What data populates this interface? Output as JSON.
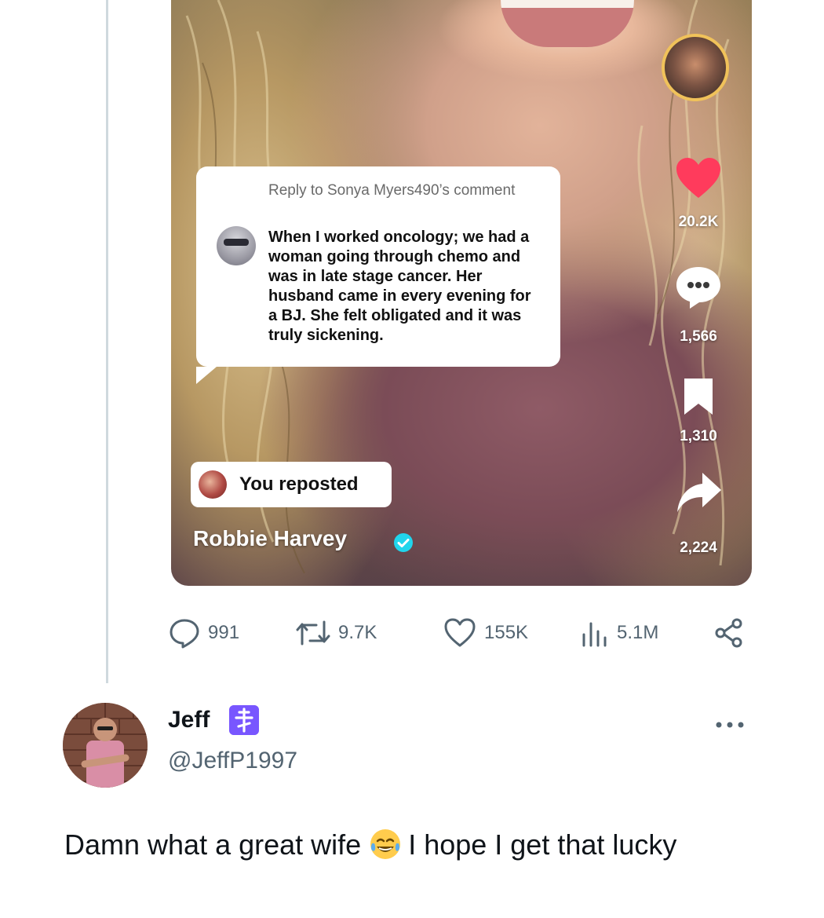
{
  "video": {
    "reply_to": "Reply to Sonya Myers490’s comment",
    "comment_text": "When I worked oncology; we had a woman going through chemo and was in late stage cancer. Her husband came in every evening for a BJ. She felt obligated and it was truly sickening.",
    "reposted_label": "You reposted",
    "author_name": "Robbie Harvey",
    "likes": "20.2K",
    "comments": "1,566",
    "saves": "1,310",
    "shares": "2,224"
  },
  "tweet_actions": {
    "replies": "991",
    "reposts": "9.7K",
    "likes": "155K",
    "views": "5.1M"
  },
  "reply": {
    "name": "Jeff",
    "handle": "@JeffP1997",
    "text_before_emoji": "Damn what a great wife",
    "text_after_emoji": "I hope I get that lucky",
    "emoji_icon": "face-with-tears-of-joy-icon",
    "badge_icon": "orthodox-cross-icon"
  },
  "colors": {
    "like_red": "#ff3b5c",
    "verified_blue": "#20d5ec",
    "badge_purple": "#7856ff",
    "meta_gray": "#536471"
  }
}
